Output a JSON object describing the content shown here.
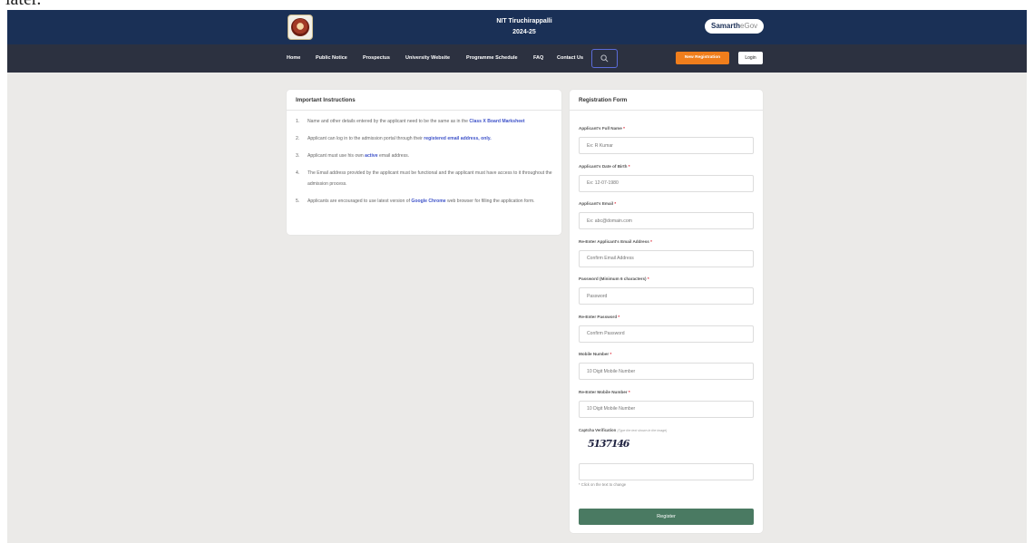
{
  "top_strip_text": "later.",
  "header": {
    "logo_alt": "NIT Tiruchirappalli emblem",
    "institute": "NIT Tiruchirappalli",
    "session": "2024-25",
    "brand_main": "Samarth",
    "brand_sub": "eGov"
  },
  "nav": {
    "items": [
      "Home",
      "Public Notice",
      "Prospectus",
      "University Website",
      "Programme Schedule",
      "FAQ",
      "Contact Us"
    ],
    "search_icon": "search-icon",
    "new_registration": "New Registration",
    "login": "Login"
  },
  "instructions": {
    "title": "Important Instructions",
    "items": [
      {
        "num": "1.",
        "pre": "Name and other details entered by the applicant need to be the same as in the ",
        "hl": "Class X Board Marksheet",
        "post": ""
      },
      {
        "num": "2.",
        "pre": "Applicant can log in to the admission portal through their ",
        "hl": "registered email address, only.",
        "post": ""
      },
      {
        "num": "3.",
        "pre": "Applicant must use his own ",
        "hl": "active",
        "post": " email address."
      },
      {
        "num": "4.",
        "pre": "The Email address provided by the applicant must be functional and the applicant must have access to it throughout the admission process.",
        "hl": "",
        "post": ""
      },
      {
        "num": "5.",
        "pre": "Applicants are encouraged to use latest version of ",
        "hl": "Google Chrome",
        "post": " web browser for filling the application form."
      }
    ]
  },
  "form": {
    "title": "Registration Form",
    "fields": [
      {
        "label": "Applicant's Full Name",
        "placeholder": "Ex: R Kumar"
      },
      {
        "label": "Applicant's Date of Birth",
        "placeholder": "Ex: 12-07-1980"
      },
      {
        "label": "Applicant's Email",
        "placeholder": "Ex: abc@domain.com"
      },
      {
        "label": "Re-Enter Applicant's Email Address",
        "placeholder": "Confirm Email Address"
      },
      {
        "label": "Password (Minimum 6 characters)",
        "placeholder": "Password"
      },
      {
        "label": "Re-Enter Password",
        "placeholder": "Confirm Password"
      },
      {
        "label": "Mobile Number",
        "placeholder": "10 Digit Mobile Number"
      },
      {
        "label": "Re-Enter Mobile Number",
        "placeholder": "10 Digit Mobile Number"
      }
    ],
    "required_mark": "*",
    "captcha_label": "Captcha Verification",
    "captcha_hint": "(Type the text shown in the image)",
    "captcha_text": "5137146",
    "captcha_value": "",
    "captcha_note": "* Click on the text to change",
    "register": "Register"
  },
  "colors": {
    "header_bg": "#1a3056",
    "nav_bg": "#2c3140",
    "accent_orange": "#f07e1c",
    "register_green": "#4a7a62",
    "link_blue": "#3f53c9"
  }
}
